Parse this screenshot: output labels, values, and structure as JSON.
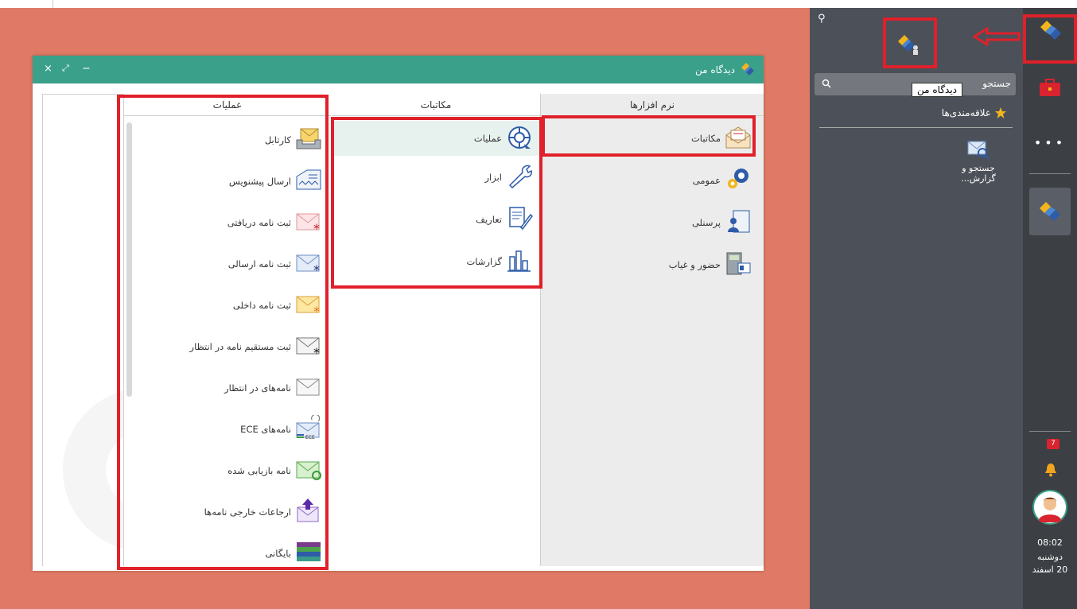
{
  "window": {
    "title": "دیدگاه من",
    "close": "×",
    "maximize": "⤢",
    "minimize": "−"
  },
  "columns": {
    "apps": {
      "header": "نرم افزارها",
      "items": [
        {
          "label": "مکاتبات",
          "icon": "envelope-open-icon"
        },
        {
          "label": "عمومی",
          "icon": "gears-icon"
        },
        {
          "label": "پرسنلی",
          "icon": "personnel-icon"
        },
        {
          "label": "حضور و غیاب",
          "icon": "time-attendance-icon"
        }
      ]
    },
    "makatebat": {
      "header": "مکاتبات",
      "items": [
        {
          "label": "عملیات",
          "icon": "operations-wheel-icon"
        },
        {
          "label": "ابزار",
          "icon": "wrench-icon"
        },
        {
          "label": "تعاریف",
          "icon": "document-pen-icon"
        },
        {
          "label": "گزارشات",
          "icon": "bar-chart-icon"
        }
      ]
    },
    "ops": {
      "header": "عملیات",
      "items": [
        {
          "label": "کارتابل",
          "icon": "inbox-tray-icon"
        },
        {
          "label": "ارسال پیشنویس",
          "icon": "draft-send-icon"
        },
        {
          "label": "ثبت نامه دریافتی",
          "icon": "mail-received-icon"
        },
        {
          "label": "ثبت نامه ارسالی",
          "icon": "mail-sent-icon"
        },
        {
          "label": "ثبت نامه داخلی",
          "icon": "mail-internal-icon"
        },
        {
          "label": "ثبت مستقیم نامه در انتظار",
          "icon": "mail-direct-icon"
        },
        {
          "label": "نامه‌های در انتظار",
          "icon": "mail-pending-icon"
        },
        {
          "label": "نامه‌های ECE",
          "icon": "mail-ece-icon",
          "badge": "ECE"
        },
        {
          "label": "نامه بازیابی شده",
          "icon": "mail-restored-icon"
        },
        {
          "label": "ارجاعات خارجی نامه‌ها",
          "icon": "mail-external-refer-icon"
        },
        {
          "label": "بایگانی",
          "icon": "archive-books-icon"
        }
      ]
    }
  },
  "panel": {
    "search_placeholder": "جستجو",
    "tooltip": "دیدگاه من",
    "favorites": "علاقه‌مندی‌ها",
    "fav_item": "جستجو و گزارش..."
  },
  "rail": {
    "badge_count": "7",
    "time": "08:02",
    "day": "دوشنبه",
    "date": "20 اسفند"
  },
  "colors": {
    "desktop": "#e07a66",
    "titlebar": "#3aa08a",
    "panel": "#4c5058",
    "rail": "#3c3f44",
    "highlight": "#e0202a"
  }
}
